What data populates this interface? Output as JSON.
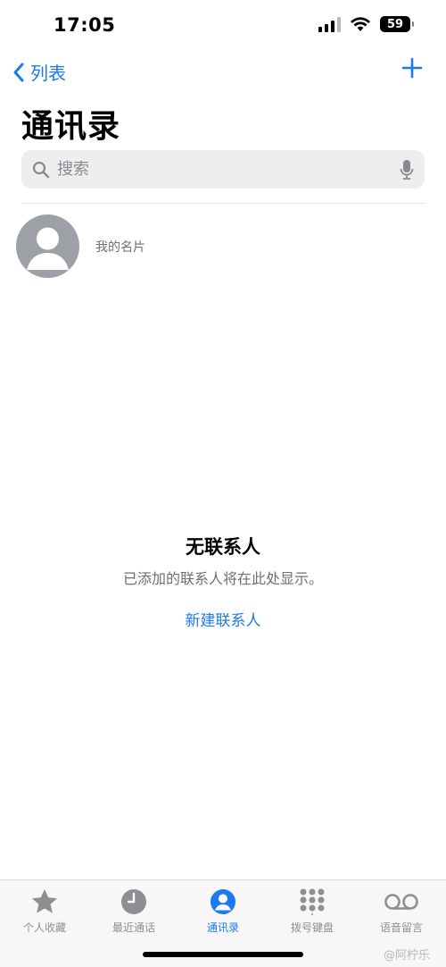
{
  "status_bar": {
    "time": "17:05",
    "battery": "59"
  },
  "nav": {
    "back_label": "列表"
  },
  "header": {
    "title": "通讯录"
  },
  "search": {
    "placeholder": "搜索"
  },
  "my_card": {
    "label": "我的名片"
  },
  "empty_state": {
    "title": "无联系人",
    "subtitle": "已添加的联系人将在此处显示。",
    "action": "新建联系人"
  },
  "tabbar": {
    "items": [
      {
        "label": "个人收藏",
        "icon": "star-icon"
      },
      {
        "label": "最近通话",
        "icon": "clock-icon"
      },
      {
        "label": "通讯录",
        "icon": "person-circle-icon",
        "active": true
      },
      {
        "label": "拨号键盘",
        "icon": "keypad-icon"
      },
      {
        "label": "语音留言",
        "icon": "voicemail-icon"
      }
    ]
  },
  "watermark": "@阿柠乐",
  "colors": {
    "accent": "#1b7af0",
    "inactive": "#8e8e93",
    "search_bg": "#eeeef0"
  }
}
